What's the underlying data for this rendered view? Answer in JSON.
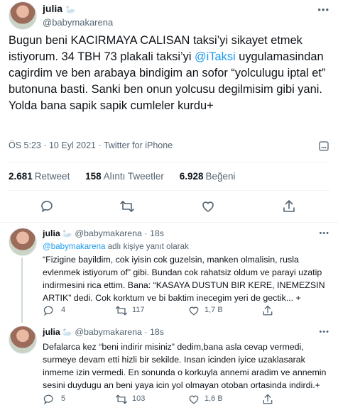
{
  "tweet": {
    "name": "julia",
    "name_emoji": "🦢",
    "handle": "@babymakarena",
    "text_parts": [
      "Bugun beni KACIRMAYA CALISAN taksi’yi sikayet etmek istiyorum. 34 TBH 73 plakali taksi’yi ",
      "@iTaksi",
      " uygulamasindan cagirdim ve ben arabaya bindigim an sofor “yolculugu iptal et” butonuna basti. Sanki ben onun yolcusu degilmisim gibi yani. Yolda bana sapik sapik cumleler kurdu+"
    ],
    "timestamp": "ÖS 5:23 · 10 Eyl 2021 · Twitter for iPhone",
    "stats": {
      "retweets_count": "2.681",
      "retweets_label": "Retweet",
      "quotes_count": "158",
      "quotes_label": "Alıntı Tweetler",
      "likes_count": "6.928",
      "likes_label": "Beğeni"
    }
  },
  "replies": [
    {
      "name": "julia",
      "name_emoji": "🦢",
      "handle": "@babymakarena",
      "time": "· 18s",
      "reply_to_handle": "@babymakarena",
      "reply_to_suffix": " adlı kişiye yanıt olarak",
      "text": "“Fizigine bayildim, cok iyisin cok guzelsin, manken olmalisin, rusla evlenmek istiyorum of” gibi. Bundan cok rahatsiz oldum ve parayi uzatip indirmesini rica ettim. Bana: “KASAYA DUSTUN BIR KERE, INEMEZSIN ARTIK” dedi. Cok korktum ve bi baktim inecegim yeri de gectik... +",
      "reply_count": "4",
      "retweet_count": "117",
      "like_count": "1,7 B"
    },
    {
      "name": "julia",
      "name_emoji": "🦢",
      "handle": "@babymakarena",
      "time": "· 18s",
      "text": "Defalarca kez “beni indirir misiniz” dedim,bana asla cevap vermedi, surmeye devam etti hizli bir sekilde. Insan icinden iyice uzaklasarak inmeme izin vermedi.  En sonunda o korkuyla annemi aradim ve annemin sesini duydugu an beni yaya icin yol olmayan otoban ortasinda indirdi.+",
      "reply_count": "5",
      "retweet_count": "103",
      "like_count": "1,6 B"
    }
  ],
  "icons": [
    "more-icon",
    "reply-icon",
    "retweet-icon",
    "like-icon",
    "share-icon"
  ],
  "colors": {
    "link": "#1d9bf0",
    "muted": "#536471",
    "text": "#0f1419"
  }
}
